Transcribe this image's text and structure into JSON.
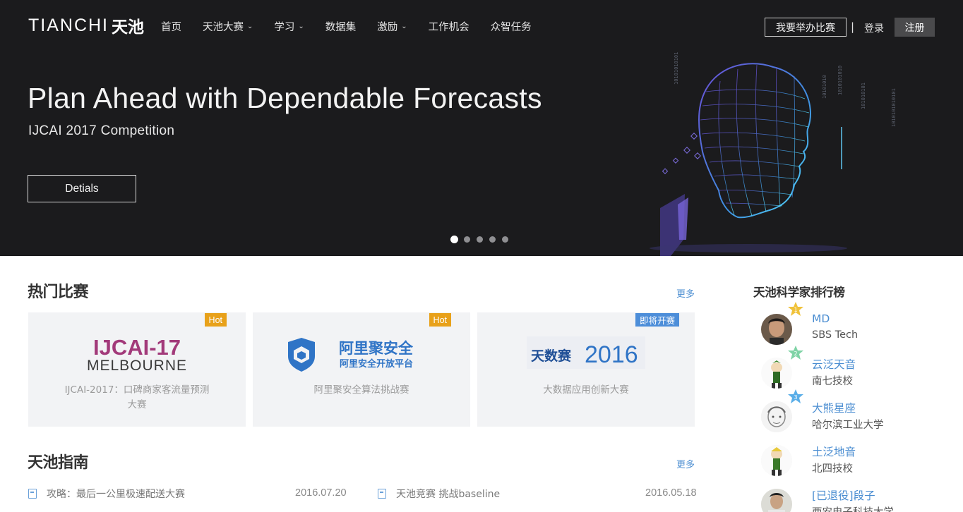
{
  "brand": {
    "logo_text": "TIANCHI",
    "logo_cn": "天池"
  },
  "nav": {
    "items": [
      {
        "label": "首页",
        "has_dropdown": false
      },
      {
        "label": "天池大赛",
        "has_dropdown": true
      },
      {
        "label": "学习",
        "has_dropdown": true
      },
      {
        "label": "数据集",
        "has_dropdown": false
      },
      {
        "label": "激励",
        "has_dropdown": true
      },
      {
        "label": "工作机会",
        "has_dropdown": false
      },
      {
        "label": "众智任务",
        "has_dropdown": false
      }
    ],
    "host_label": "我要举办比赛",
    "separator": "|",
    "login_label": "登录",
    "register_label": "注册"
  },
  "hero": {
    "title": "Plan Ahead with Dependable Forecasts",
    "subtitle": "IJCAI 2017 Competition",
    "button_label": "Detials",
    "slide_count": 5,
    "active_slide": 1
  },
  "hot_competitions": {
    "title": "热门比赛",
    "more_label": "更多",
    "cards": [
      {
        "badge": "Hot",
        "badge_type": "hot",
        "logo_main": "IJCAI-17",
        "logo_sub": "MELBOURNE",
        "name": "IJCAI-2017：口碑商家客流量预测大赛"
      },
      {
        "badge": "Hot",
        "badge_type": "hot",
        "logo_main": "阿里聚安全",
        "logo_sub": "阿里安全开放平台",
        "name": "阿里聚安全算法挑战赛"
      },
      {
        "badge": "即将开赛",
        "badge_type": "soon",
        "logo_main": "天数赛",
        "logo_sub": "2016",
        "name": "大数据应用创新大赛"
      }
    ]
  },
  "guide": {
    "title": "天池指南",
    "more_label": "更多",
    "items": [
      {
        "title": "攻略：最后一公里极速配送大赛",
        "date": "2016.07.20"
      },
      {
        "title": "天池竞赛 挑战baseline",
        "date": "2016.05.18"
      }
    ]
  },
  "ranking": {
    "title": "天池科学家排行榜",
    "items": [
      {
        "rank": "1",
        "name": "MD",
        "org": "SBS Tech"
      },
      {
        "rank": "2",
        "name": "云泛天音",
        "org": "南七技校"
      },
      {
        "rank": "3",
        "name": "大熊星座",
        "org": "哈尔滨工业大学"
      },
      {
        "rank": "",
        "name": "土泛地音",
        "org": "北四技校"
      },
      {
        "rank": "",
        "name": "[已退役]段子",
        "org": "西安电子科技大学"
      }
    ]
  },
  "colors": {
    "hero_bg": "#1b1b1d",
    "link_blue": "#4a8dd1",
    "hot_badge": "#e8a11a",
    "soon_badge": "#4d8ed9",
    "card_bg": "#f2f3f5"
  }
}
